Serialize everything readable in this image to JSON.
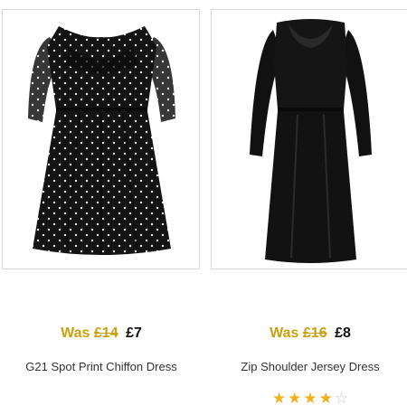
{
  "products": [
    {
      "was_label": "Was",
      "old_price": "£14",
      "new_price": "£7",
      "name": "G21 Spot Print Chiffon Dress"
    },
    {
      "was_label": "Was",
      "old_price": "£16",
      "new_price": "£8",
      "name": "Zip Shoulder Jersey Dress",
      "rating": 4,
      "rating_max": 5
    }
  ],
  "colors": {
    "price_accent": "#c8a10e",
    "star_fill": "#f2b01e",
    "star_empty": "#c8c8c8"
  }
}
